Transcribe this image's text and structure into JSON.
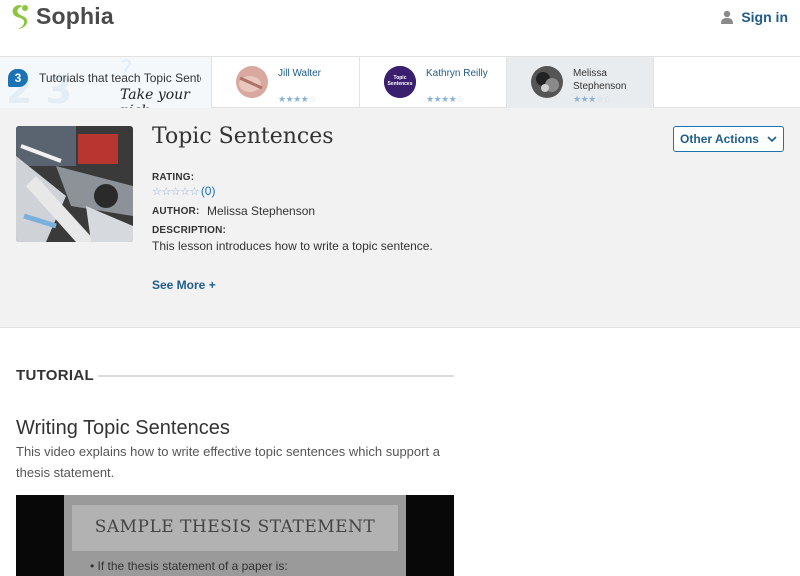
{
  "header": {
    "logo_text": "Sophia",
    "signin_label": "Sign in"
  },
  "strip": {
    "count": "3",
    "text": "Tutorials that teach Topic Sentences",
    "pick_label": "Take your pick:",
    "tutors": [
      {
        "name": "Jill Walter",
        "stars": 4,
        "active": false
      },
      {
        "name": "Kathryn Reilly",
        "stars": 4,
        "active": false,
        "avatar_text": "Topic Sentences"
      },
      {
        "name": "Melissa Stephenson",
        "stars": 3,
        "active": true
      }
    ]
  },
  "lesson": {
    "title": "Topic Sentences",
    "rating_label": "RATING:",
    "rating_count": "(0)",
    "author_label": "AUTHOR:",
    "author": "Melissa Stephenson",
    "description_label": "DESCRIPTION:",
    "description": "This lesson introduces how to write a topic sentence.",
    "see_more": "See More +",
    "other_actions": "Other Actions"
  },
  "tutorial": {
    "section_label": "TUTORIAL",
    "heading": "Writing Topic Sentences",
    "lead": "This video explains how to write effective topic sentences which support a thesis statement."
  },
  "video": {
    "slide_title": "SAMPLE THESIS STATEMENT",
    "slide_bullet": "If the thesis statement of a paper is:"
  },
  "colors": {
    "accent": "#1b73b3",
    "link": "#1f5c8a",
    "panel_bg": "#f2f2f2"
  }
}
